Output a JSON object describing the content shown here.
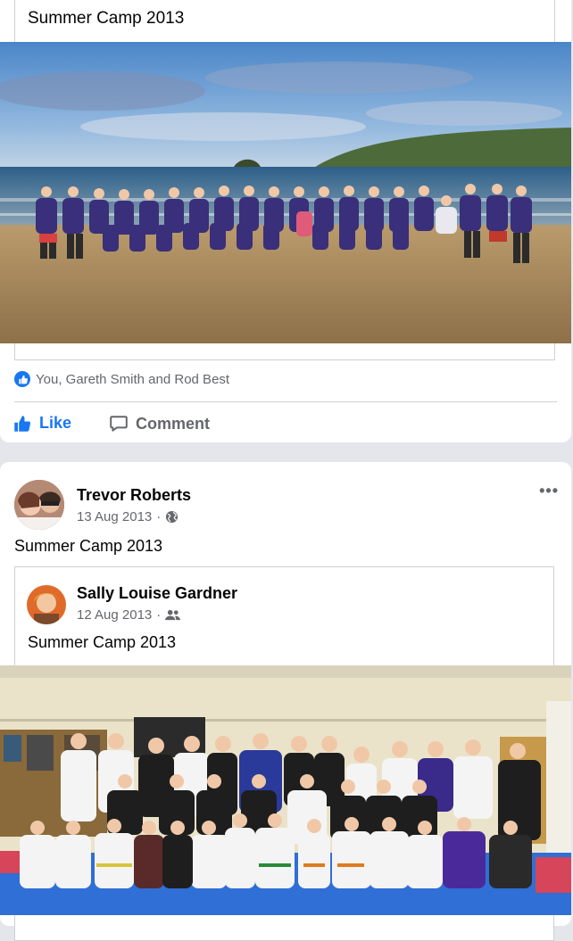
{
  "post1": {
    "shared_caption": "Summer Camp 2013",
    "reactions_text": "You, Gareth Smith and Rod Best",
    "like_label": "Like",
    "comment_label": "Comment",
    "accent": "#1877f2"
  },
  "post2": {
    "author": "Trevor Roberts",
    "date": "13 Aug 2013",
    "audience_icon": "globe-icon",
    "text": "Summer Camp 2013",
    "more_label": "•••",
    "shared": {
      "author": "Sally Louise Gardner",
      "date": "12 Aug 2013",
      "audience_icon": "friends-icon",
      "text": "Summer Camp 2013"
    }
  }
}
